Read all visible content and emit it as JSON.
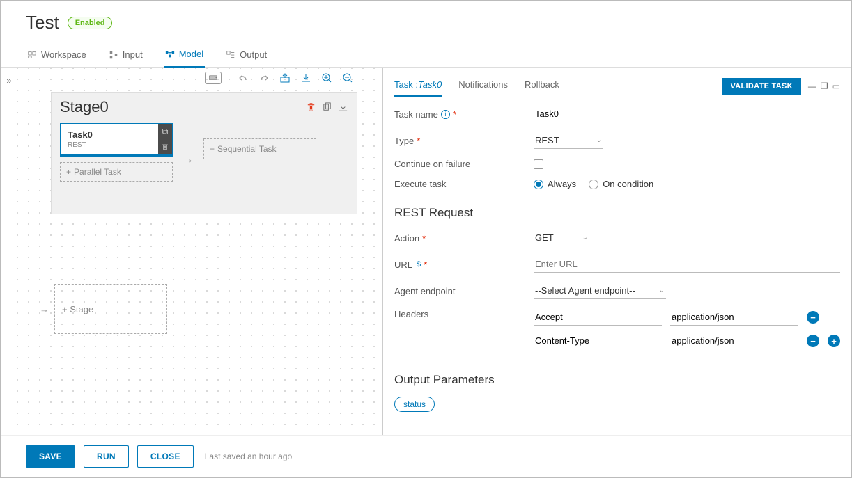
{
  "header": {
    "title": "Test",
    "badge": "Enabled"
  },
  "tabs": {
    "workspace": "Workspace",
    "input": "Input",
    "model": "Model",
    "output": "Output"
  },
  "canvas": {
    "stage": {
      "title": "Stage0",
      "task": {
        "name": "Task0",
        "type": "REST"
      },
      "add_parallel": "Parallel Task",
      "add_sequential": "Sequential Task"
    },
    "add_stage": "Stage"
  },
  "details": {
    "subtabs": {
      "task_prefix": "Task :",
      "task_name": "Task0",
      "notifications": "Notifications",
      "rollback": "Rollback"
    },
    "validate": "VALIDATE TASK",
    "fields": {
      "task_name_label": "Task name",
      "task_name_value": "Task0",
      "type_label": "Type",
      "type_value": "REST",
      "continue_label": "Continue on failure",
      "execute_label": "Execute task",
      "radio_always": "Always",
      "radio_condition": "On condition"
    },
    "rest": {
      "title": "REST Request",
      "action_label": "Action",
      "action_value": "GET",
      "url_label": "URL",
      "url_placeholder": "Enter URL",
      "agent_label": "Agent endpoint",
      "agent_value": "--Select Agent endpoint--",
      "headers_label": "Headers",
      "headers": [
        {
          "key": "Accept",
          "value": "application/json"
        },
        {
          "key": "Content-Type",
          "value": "application/json"
        }
      ]
    },
    "output": {
      "title": "Output Parameters",
      "pill": "status"
    }
  },
  "footer": {
    "save": "SAVE",
    "run": "RUN",
    "close": "CLOSE",
    "saved": "Last saved an hour ago"
  }
}
